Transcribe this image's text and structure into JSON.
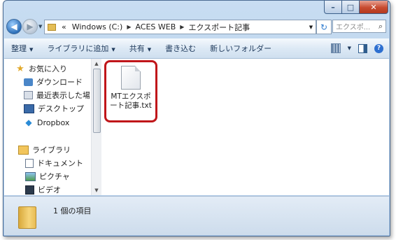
{
  "window": {
    "controls": {
      "minimize": "–",
      "maximize": "□",
      "close": "✕"
    }
  },
  "address_bar": {
    "prefix": "«",
    "breadcrumbs": [
      "Windows (C:)",
      "ACES WEB",
      "エクスポート記事"
    ],
    "separator": "▶",
    "search_placeholder": "エクスポ..."
  },
  "toolbar": {
    "organize": "整理",
    "add_to_library": "ライブラリに追加",
    "share": "共有",
    "burn": "書き込む",
    "new_folder": "新しいフォルダー",
    "help": "?"
  },
  "sidebar": {
    "favorites": "お気に入り",
    "downloads": "ダウンロード",
    "recent": "最近表示した場所",
    "desktop": "デスクトップ",
    "dropbox": "Dropbox",
    "libraries": "ライブラリ",
    "documents": "ドキュメント",
    "pictures": "ピクチャ",
    "videos": "ビデオ"
  },
  "files": [
    {
      "name": "MTエクスポート記事.txt"
    }
  ],
  "status": {
    "text": "1 個の項目"
  },
  "colors": {
    "highlight_border": "#c0161a",
    "toolbar_text": "#1e395b"
  }
}
